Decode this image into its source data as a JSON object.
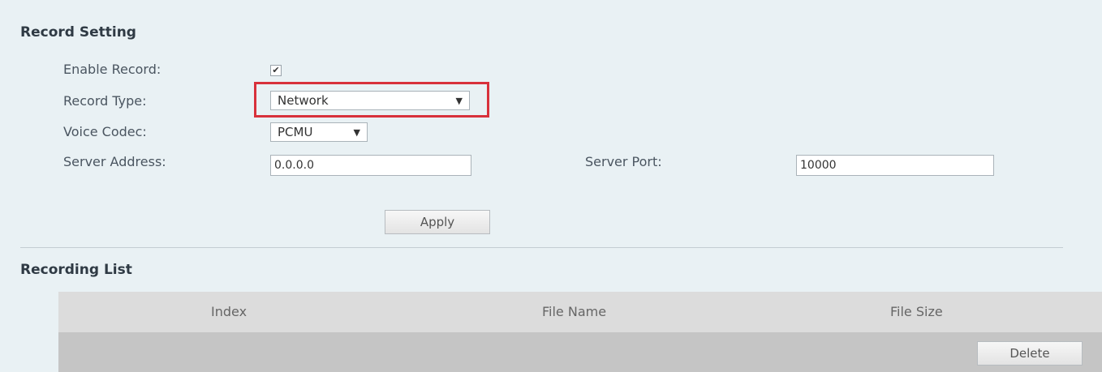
{
  "record_setting": {
    "title": "Record Setting",
    "enable_record": {
      "label": "Enable Record:",
      "checked": true,
      "mark": "✔"
    },
    "record_type": {
      "label": "Record Type:",
      "value": "Network"
    },
    "voice_codec": {
      "label": "Voice Codec:",
      "value": "PCMU"
    },
    "server_address": {
      "label": "Server Address:",
      "value": "0.0.0.0"
    },
    "server_port": {
      "label": "Server Port:",
      "value": "10000"
    },
    "apply_label": "Apply",
    "highlight_color": "#d8313b"
  },
  "recording_list": {
    "title": "Recording List",
    "columns": [
      "Index",
      "File Name",
      "File Size"
    ],
    "delete_label": "Delete"
  },
  "icons": {
    "dropdown": "dropdown-arrow-icon",
    "check": "checkmark-icon"
  }
}
